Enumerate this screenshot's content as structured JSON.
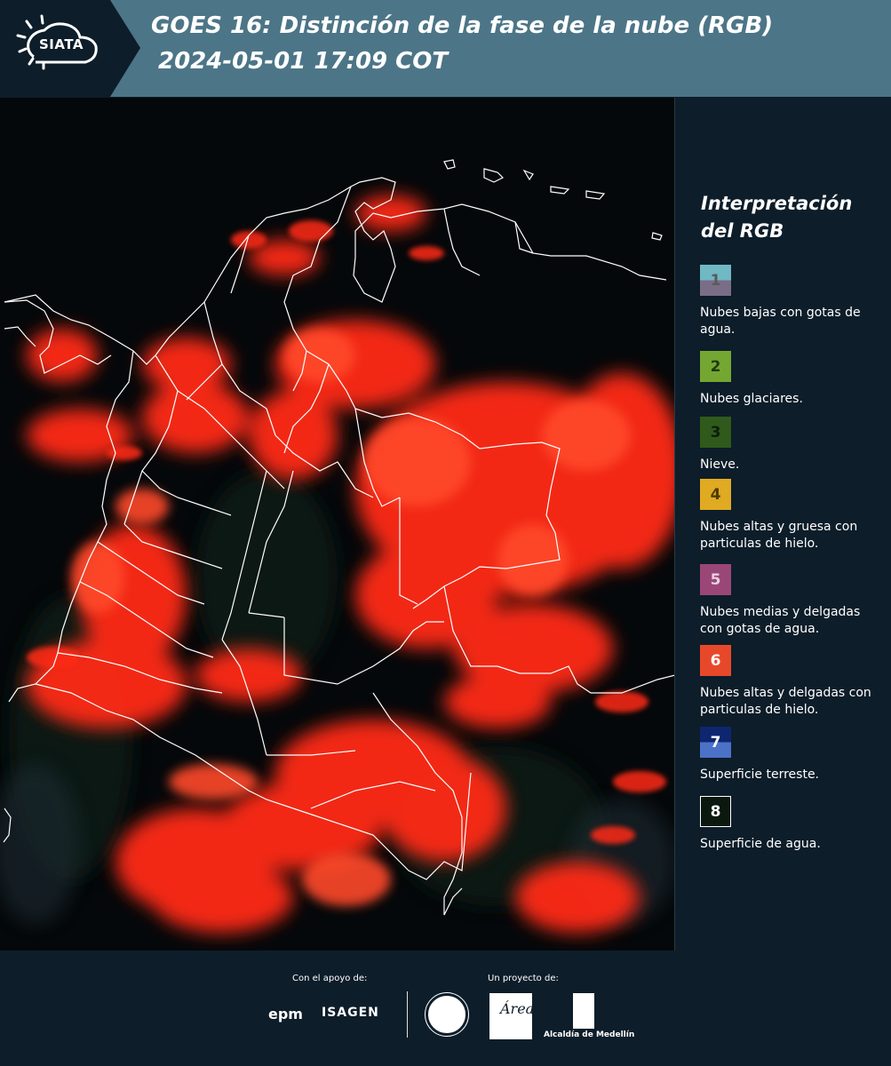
{
  "header": {
    "logo_text": "SIATA",
    "title_line1": "GOES 16: Distinción de la fase de la nube (RGB)",
    "title_line2": "2024-05-01 17:09 COT",
    "background_color": "#4c7587"
  },
  "map": {
    "region": "",
    "cloud_color": "#ff2a12",
    "background_color": "#05080a",
    "border_color": "#ffffff"
  },
  "legend": {
    "title": "Interpretación del RGB",
    "items": [
      {
        "number": "1",
        "label": "Nubes bajas con gotas de agua.",
        "color_top": "#6fb8c4",
        "color_bottom": "#7a6d88",
        "text_color": "#5a5a5a"
      },
      {
        "number": "2",
        "label": "Nubes glaciares.",
        "color_top": "#74a632",
        "color_bottom": "#74a632",
        "text_color": "#1f3a10"
      },
      {
        "number": "3",
        "label": "Nieve.",
        "color_top": "#2f5a1c",
        "color_bottom": "#2f5a1c",
        "text_color": "#0d1d0a"
      },
      {
        "number": "4",
        "label": "Nubes altas y gruesa con particulas de hielo.",
        "color_top": "#e0aa22",
        "color_bottom": "#e0aa22",
        "text_color": "#4d3a00"
      },
      {
        "number": "5",
        "label": "Nubes medias y delgadas con gotas de agua.",
        "color_top": "#9a4778",
        "color_bottom": "#9a4778",
        "text_color": "#e8d0e0"
      },
      {
        "number": "6",
        "label": "Nubes altas y delgadas con particulas de hielo.",
        "color_top": "#e8482a",
        "color_bottom": "#e8482a",
        "text_color": "#ffffff"
      },
      {
        "number": "7",
        "label": "Superficie terreste.",
        "color_top": "#0e2670",
        "color_bottom": "#4c72c8",
        "text_color": "#ffffff"
      },
      {
        "number": "8",
        "label": "Superficie de agua.",
        "color_top": "#0b1810",
        "color_bottom": "#0b1810",
        "text_color": "#ffffff"
      }
    ]
  },
  "footer": {
    "support_label": "Con el apoyo de:",
    "project_label": "Un proyecto de:",
    "sponsor_1": "epm",
    "sponsor_2": "ISAGEN",
    "partner_area": "Área",
    "partner_medellin": "Alcaldía de Medellín"
  }
}
